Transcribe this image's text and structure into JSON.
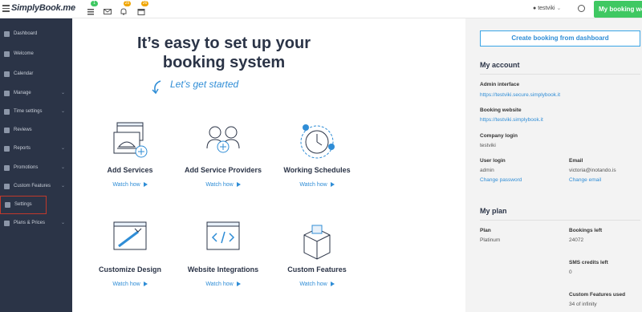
{
  "topbar": {
    "logo": "SimplyBook.me",
    "badges": {
      "tasks": "1",
      "notifications": "25",
      "calendar": "26"
    },
    "user": "testviki",
    "my_booking_label": "My booking website"
  },
  "sidebar": {
    "items": [
      {
        "label": "Dashboard",
        "chevron": false
      },
      {
        "label": "Welcome",
        "chevron": false
      },
      {
        "label": "Calendar",
        "chevron": false
      },
      {
        "label": "Manage",
        "chevron": true
      },
      {
        "label": "Time settings",
        "chevron": true
      },
      {
        "label": "Reviews",
        "chevron": false
      },
      {
        "label": "Reports",
        "chevron": true
      },
      {
        "label": "Promotions",
        "chevron": true
      },
      {
        "label": "Custom Features",
        "chevron": true
      },
      {
        "label": "Settings",
        "chevron": false
      },
      {
        "label": "Plans & Prices",
        "chevron": true
      }
    ]
  },
  "main": {
    "headline": "It’s easy to set up your booking system",
    "subheadline": "Let’s get started",
    "watch_label": "Watch how",
    "features": [
      {
        "title": "Add Services",
        "icon": "services-icon"
      },
      {
        "title": "Add Service Providers",
        "icon": "providers-icon"
      },
      {
        "title": "Working Schedules",
        "icon": "schedule-icon"
      },
      {
        "title": "Customize Design",
        "icon": "design-icon"
      },
      {
        "title": "Website Integrations",
        "icon": "integrations-icon"
      },
      {
        "title": "Custom Features",
        "icon": "features-icon"
      }
    ]
  },
  "right": {
    "create_button": "Create booking from dashboard",
    "account_title": "My account",
    "admin_label": "Admin interface",
    "admin_url": "https://testviki.secure.simplybook.it",
    "booking_label": "Booking website",
    "booking_url": "https://testviki.simplybook.it",
    "company_label": "Company login",
    "company_value": "testviki",
    "user_login_label": "User login",
    "user_login_value": "admin",
    "change_password": "Change password",
    "email_label": "Email",
    "email_value": "victoria@inotando.is",
    "change_email": "Change email",
    "plan_title": "My plan",
    "plan_label": "Plan",
    "plan_value": "Platinum",
    "bookings_left_label": "Bookings left",
    "bookings_left_value": "24072",
    "sms_label": "SMS credits left",
    "sms_value": "0",
    "custom_used_label": "Custom Features used",
    "custom_used_value": "34 of infinity"
  },
  "colors": {
    "sidebar": "#2b3447",
    "accent": "#2f8dd6",
    "green": "#3fc862"
  }
}
